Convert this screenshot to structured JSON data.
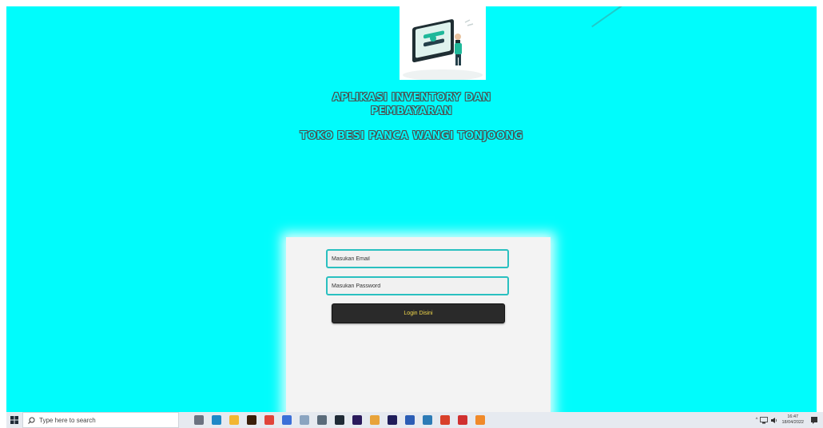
{
  "header": {
    "title_line1": "APLIKASI INVENTORY DAN",
    "title_line2": "PEMBAYARAN",
    "subtitle": "TOKO BESI PANCA WANGI TONJOONG"
  },
  "login": {
    "email_placeholder": "Masukan Email",
    "password_placeholder": "Masukan Password",
    "button_label": "Login Disini"
  },
  "taskbar": {
    "search_placeholder": "Type here to search",
    "clock_time": "16:47",
    "clock_date": "18/04/2022",
    "tray_arrow": "^",
    "apps": [
      {
        "name": "task-view-icon",
        "color": "#6b7280"
      },
      {
        "name": "edge-icon",
        "color": "#1e88c7"
      },
      {
        "name": "file-explorer-icon",
        "color": "#f2b632"
      },
      {
        "name": "illustrator-icon",
        "color": "#3a1f0a"
      },
      {
        "name": "app-red-icon",
        "color": "#e0443a"
      },
      {
        "name": "app-blue-icon",
        "color": "#3b6fd8"
      },
      {
        "name": "pen-icon",
        "color": "#8aa4c0"
      },
      {
        "name": "app-gray-icon",
        "color": "#5a6b7a"
      },
      {
        "name": "app-dark-icon",
        "color": "#1f2a36"
      },
      {
        "name": "after-effects-icon",
        "color": "#2a1a5c"
      },
      {
        "name": "chrome-icon",
        "color": "#e8a33a"
      },
      {
        "name": "premiere-icon",
        "color": "#1f1d5a"
      },
      {
        "name": "word-icon",
        "color": "#2b5db5"
      },
      {
        "name": "app-round-icon",
        "color": "#2c7bb6"
      },
      {
        "name": "office-icon",
        "color": "#d8402a"
      },
      {
        "name": "wps-icon",
        "color": "#d03030"
      },
      {
        "name": "xampp-icon",
        "color": "#f08a2a"
      }
    ]
  }
}
